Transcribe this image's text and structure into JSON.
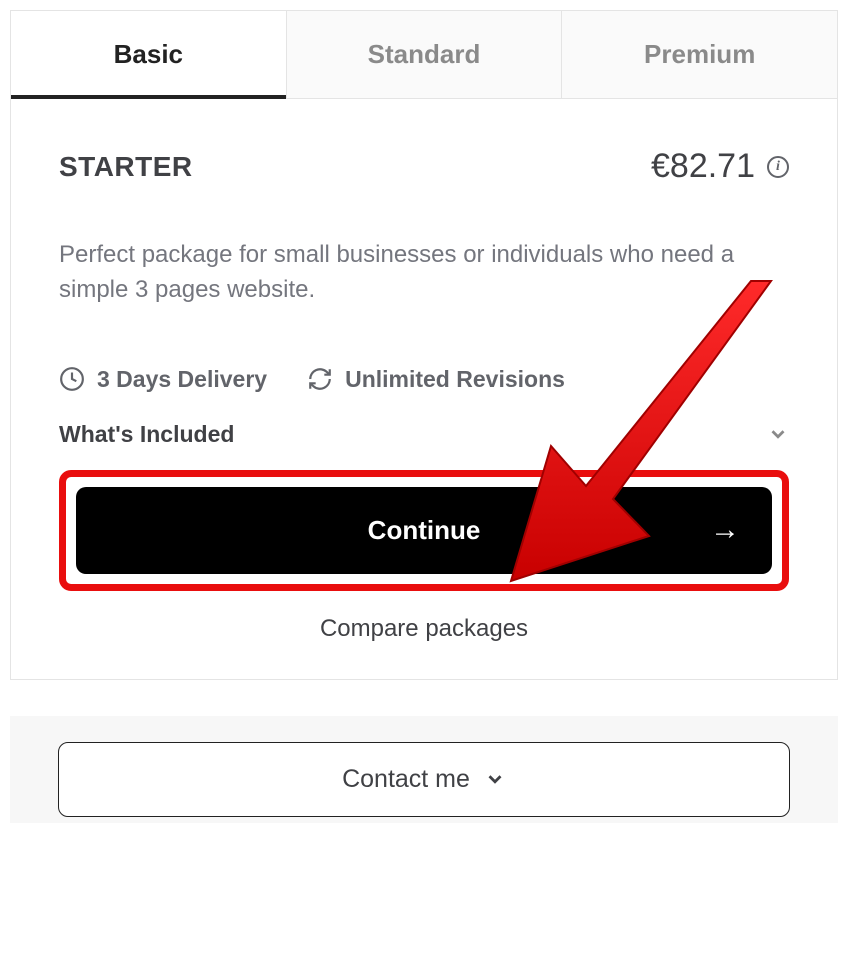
{
  "tabs": {
    "basic": "Basic",
    "standard": "Standard",
    "premium": "Premium"
  },
  "plan": {
    "name": "STARTER",
    "price": "€82.71",
    "description": "Perfect package for small businesses or individuals who need a simple 3 pages website.",
    "delivery": "3 Days Delivery",
    "revisions": "Unlimited Revisions",
    "included_label": "What's Included"
  },
  "buttons": {
    "continue": "Continue",
    "compare": "Compare packages",
    "contact": "Contact me"
  }
}
